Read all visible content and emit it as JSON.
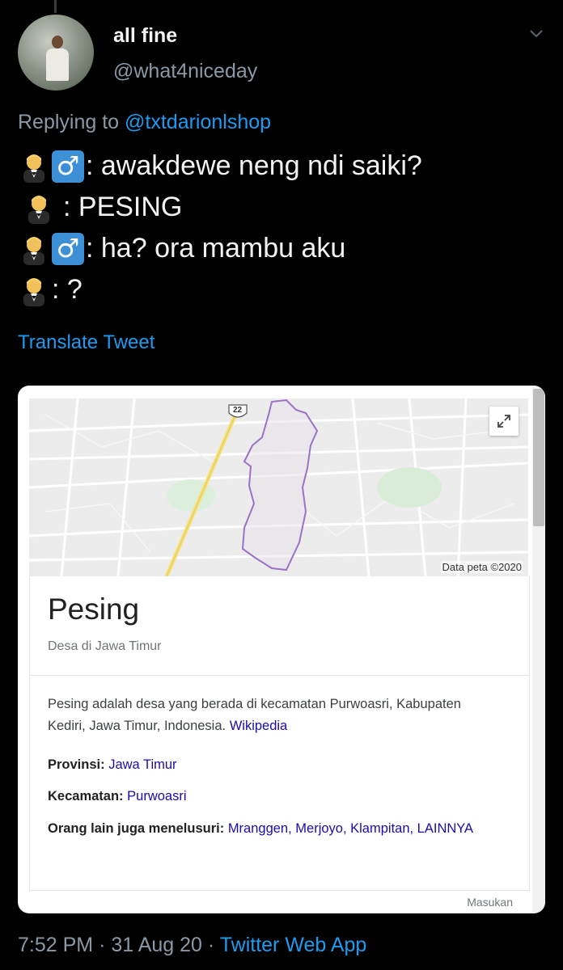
{
  "tweet": {
    "display_name": "all fine",
    "handle": "@what4niceday",
    "replying_prefix": "Replying to ",
    "replying_to": "@txtdarionlshop",
    "lines": [
      {
        "male_sign": true,
        "text": ": awakdewe neng ndi saiki?"
      },
      {
        "male_sign": false,
        "text": ": PESING"
      },
      {
        "male_sign": true,
        "text": ": ha? ora mambu aku"
      },
      {
        "male_sign": false,
        "text": ": ?"
      }
    ],
    "translate_label": "Translate Tweet",
    "time": "7:52 PM",
    "date": "31 Aug 20",
    "separator": "·",
    "source_app": "Twitter Web App"
  },
  "card": {
    "map": {
      "road_number": "22",
      "attribution": "Data peta ©2020"
    },
    "title": "Pesing",
    "subtitle": "Desa di Jawa Timur",
    "description": "Pesing adalah desa yang berada di kecamatan Purwoasri, Kabupaten Kediri, Jawa Timur, Indonesia.",
    "description_link": "Wikipedia",
    "facts": {
      "provinsi_label": "Provinsi:",
      "provinsi_value": "Jawa Timur",
      "kecamatan_label": "Kecamatan:",
      "kecamatan_value": "Purwoasri",
      "related_label": "Orang lain juga menelusuri:",
      "related_value": "Mranggen, Merjoyo, Klampitan, LAINNYA"
    },
    "feedback_label": "Masukan"
  },
  "icons": {
    "person_emoji": "man-in-tuxedo-icon",
    "male_sign": "male-sign-icon",
    "chevron": "chevron-down-icon",
    "expand": "expand-icon"
  },
  "colors": {
    "background": "#000000",
    "link_blue": "#1d9bf0",
    "muted": "#8b98a5",
    "area_outline": "#9b72c6"
  }
}
